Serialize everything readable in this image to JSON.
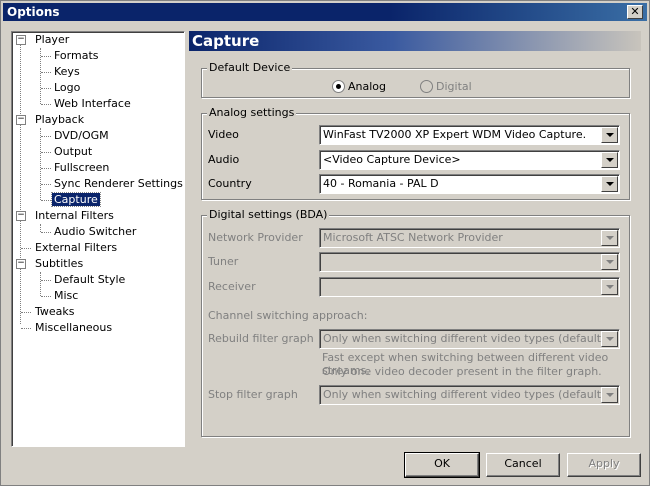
{
  "window": {
    "title": "Options",
    "close_glyph": "✕"
  },
  "tree": {
    "items": [
      {
        "label": "Player",
        "expander": "−"
      },
      {
        "label": "Formats"
      },
      {
        "label": "Keys"
      },
      {
        "label": "Logo"
      },
      {
        "label": "Web Interface"
      },
      {
        "label": "Playback",
        "expander": "−"
      },
      {
        "label": "DVD/OGM"
      },
      {
        "label": "Output"
      },
      {
        "label": "Fullscreen"
      },
      {
        "label": "Sync Renderer Settings"
      },
      {
        "label": "Capture",
        "selected": true
      },
      {
        "label": "Internal Filters",
        "expander": "−"
      },
      {
        "label": "Audio Switcher"
      },
      {
        "label": "External Filters"
      },
      {
        "label": "Subtitles",
        "expander": "−"
      },
      {
        "label": "Default Style"
      },
      {
        "label": "Misc"
      },
      {
        "label": "Tweaks"
      },
      {
        "label": "Miscellaneous"
      }
    ]
  },
  "page": {
    "title": "Capture"
  },
  "default_device": {
    "title": "Default Device",
    "analog_label": "Analog",
    "digital_label": "Digital",
    "selected": "Analog"
  },
  "analog": {
    "title": "Analog settings",
    "video_label": "Video",
    "video_value": "WinFast TV2000 XP Expert WDM Video Capture.",
    "audio_label": "Audio",
    "audio_value": "<Video Capture Device>",
    "country_label": "Country",
    "country_value": "40 - Romania - PAL D"
  },
  "digital": {
    "title": "Digital settings (BDA)",
    "network_label": "Network Provider",
    "network_value": "Microsoft ATSC Network Provider",
    "tuner_label": "Tuner",
    "tuner_value": "",
    "receiver_label": "Receiver",
    "receiver_value": "",
    "approach_label": "Channel switching approach:",
    "rebuild_label": "Rebuild filter graph",
    "rebuild_value": "Only when switching different video types (default)",
    "rebuild_note_1": "Fast except when switching between different video streams.",
    "rebuild_note_2": "Only one video decoder present in the filter graph.",
    "stop_label": "Stop filter graph",
    "stop_value": "Only when switching different video types (default)"
  },
  "buttons": {
    "ok": "OK",
    "cancel": "Cancel",
    "apply": "Apply"
  },
  "colors": {
    "title_bar": "#0a246a",
    "selection": "#0a246a",
    "face": "#d4d0c8"
  }
}
